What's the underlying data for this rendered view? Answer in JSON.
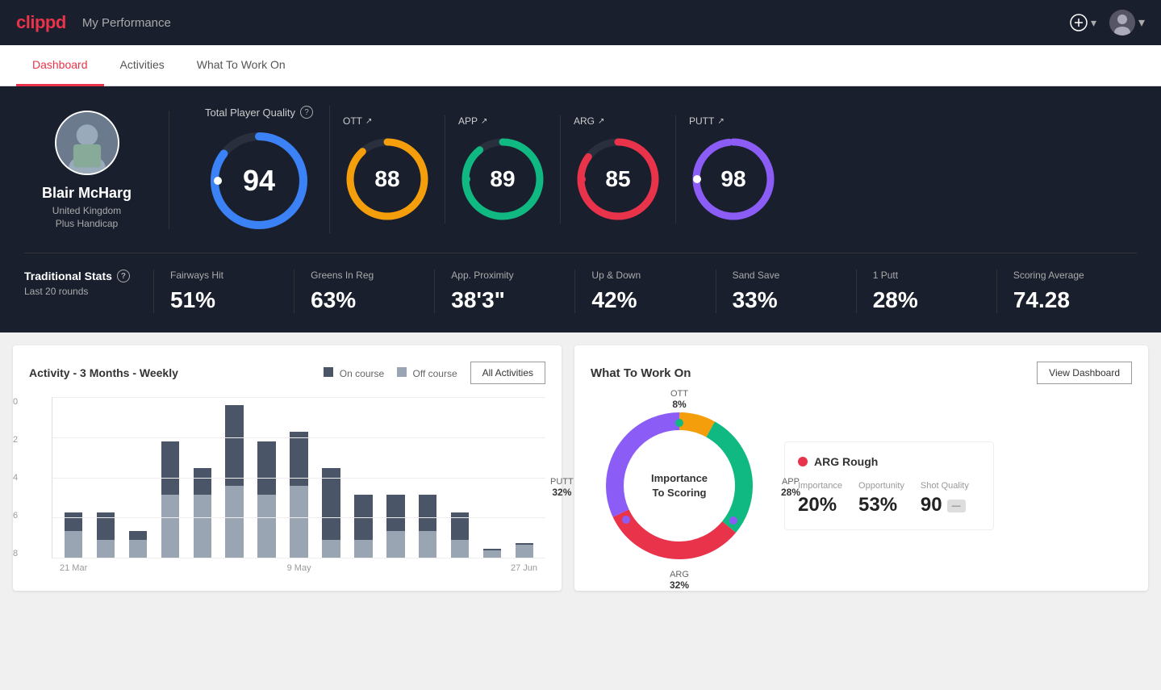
{
  "header": {
    "logo": "clippd",
    "title": "My Performance",
    "add_button_label": "+",
    "user_chevron": "▾"
  },
  "nav": {
    "tabs": [
      "Dashboard",
      "Activities",
      "What To Work On"
    ],
    "active": "Dashboard"
  },
  "player": {
    "name": "Blair McHarg",
    "country": "United Kingdom",
    "handicap": "Plus Handicap"
  },
  "quality": {
    "tpq_label": "Total Player Quality",
    "tpq_value": 94,
    "tpq_pct": 94,
    "tpq_color": "#3b82f6",
    "ott_label": "OTT",
    "ott_value": 88,
    "ott_pct": 88,
    "ott_color": "#f59e0b",
    "app_label": "APP",
    "app_value": 89,
    "app_pct": 89,
    "app_color": "#10b981",
    "arg_label": "ARG",
    "arg_value": 85,
    "arg_pct": 85,
    "arg_color": "#e8334a",
    "putt_label": "PUTT",
    "putt_value": 98,
    "putt_pct": 98,
    "putt_color": "#8b5cf6"
  },
  "traditional_stats": {
    "label": "Traditional Stats",
    "sub_label": "Last 20 rounds",
    "fairways_hit_label": "Fairways Hit",
    "fairways_hit_value": "51%",
    "greens_in_reg_label": "Greens In Reg",
    "greens_in_reg_value": "63%",
    "app_proximity_label": "App. Proximity",
    "app_proximity_value": "38'3\"",
    "up_and_down_label": "Up & Down",
    "up_and_down_value": "42%",
    "sand_save_label": "Sand Save",
    "sand_save_value": "33%",
    "one_putt_label": "1 Putt",
    "one_putt_value": "28%",
    "scoring_avg_label": "Scoring Average",
    "scoring_avg_value": "74.28"
  },
  "activity_chart": {
    "title": "Activity - 3 Months - Weekly",
    "legend_on_course": "On course",
    "legend_off_course": "Off course",
    "all_activities_btn": "All Activities",
    "y_labels": [
      "0",
      "2",
      "4",
      "6",
      "8"
    ],
    "x_labels": [
      "21 Mar",
      "9 May",
      "27 Jun"
    ],
    "bars": [
      {
        "on": 1,
        "off": 1.5
      },
      {
        "on": 1.5,
        "off": 1
      },
      {
        "on": 0.5,
        "off": 1
      },
      {
        "on": 3,
        "off": 3.5
      },
      {
        "on": 1.5,
        "off": 3.5
      },
      {
        "on": 4.5,
        "off": 4
      },
      {
        "on": 3,
        "off": 3.5
      },
      {
        "on": 3,
        "off": 4
      },
      {
        "on": 4,
        "off": 1
      },
      {
        "on": 2.5,
        "off": 1
      },
      {
        "on": 2,
        "off": 1.5
      },
      {
        "on": 2,
        "off": 1.5
      },
      {
        "on": 1.5,
        "off": 1
      },
      {
        "on": 0,
        "off": 0.5
      },
      {
        "on": 0,
        "off": 0.8
      }
    ],
    "on_color": "#4a5568",
    "off_color": "#9aa5b4"
  },
  "wtwo": {
    "title": "What To Work On",
    "view_dashboard_btn": "View Dashboard",
    "donut_center_line1": "Importance",
    "donut_center_line2": "To Scoring",
    "segments": [
      {
        "label": "OTT",
        "value": "8%",
        "color": "#f59e0b",
        "pct": 8
      },
      {
        "label": "APP",
        "value": "28%",
        "color": "#10b981",
        "pct": 28
      },
      {
        "label": "ARG",
        "value": "32%",
        "color": "#e8334a",
        "pct": 32
      },
      {
        "label": "PUTT",
        "value": "32%",
        "color": "#8b5cf6",
        "pct": 32
      }
    ],
    "detail_card": {
      "title": "ARG Rough",
      "dot_color": "#e8334a",
      "metrics": [
        {
          "label": "Importance",
          "value": "20%"
        },
        {
          "label": "Opportunity",
          "value": "53%"
        },
        {
          "label": "Shot Quality",
          "value": "90",
          "badge": ""
        }
      ]
    }
  }
}
